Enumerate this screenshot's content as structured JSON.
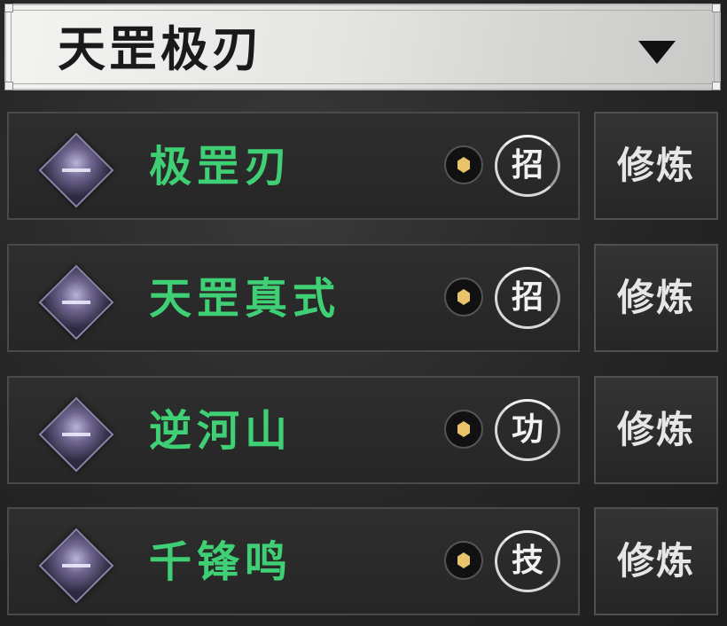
{
  "header": {
    "title": "天罡极刃",
    "dropdown_icon": "triangle-down-icon"
  },
  "skills": [
    {
      "name": "极罡刃",
      "type_badge": "招",
      "icon": "blade-slash-icon",
      "cost_icon": "gold-coin-icon",
      "action_label": "修炼"
    },
    {
      "name": "天罡真式",
      "type_badge": "招",
      "icon": "warrior-strike-icon",
      "cost_icon": "gold-coin-icon",
      "action_label": "修炼"
    },
    {
      "name": "逆河山",
      "type_badge": "功",
      "icon": "mountain-burst-icon",
      "cost_icon": "gold-coin-icon",
      "action_label": "修炼"
    },
    {
      "name": "千锋鸣",
      "type_badge": "技",
      "icon": "thousand-blades-icon",
      "cost_icon": "gold-coin-icon",
      "action_label": "修炼"
    }
  ],
  "colors": {
    "skill_name": "#3fcf74",
    "coin": "#e9c46a",
    "header_bg": "#e6e6e4"
  }
}
